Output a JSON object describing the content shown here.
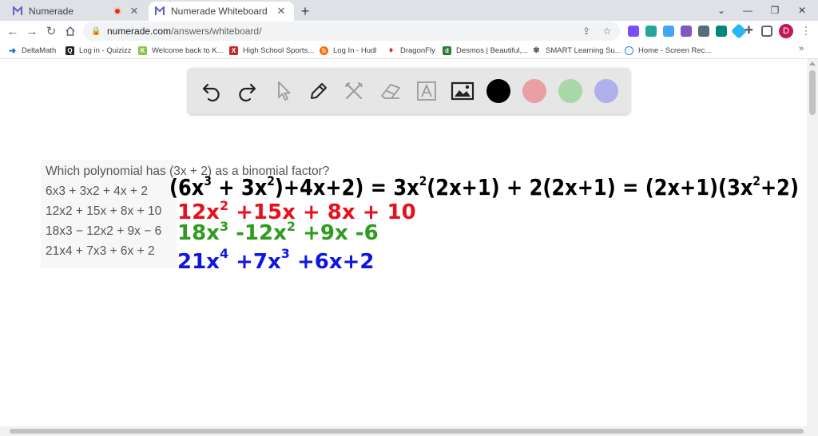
{
  "browser": {
    "tabs": [
      {
        "title": "Numerade",
        "active": false
      },
      {
        "title": "Numerade Whiteboard",
        "active": true
      }
    ],
    "url_host": "numerade.com",
    "url_path": "/answers/whiteboard/",
    "profile_initial": "D"
  },
  "bookmarks": [
    {
      "label": "DeltaMath",
      "icon": "deltamath-icon",
      "color": "#1565c0"
    },
    {
      "label": "Log in - Quizizz",
      "icon": "quizizz-icon",
      "color": "#222222"
    },
    {
      "label": "Welcome back to K...",
      "icon": "kahoot-icon",
      "color": "#8bc34a"
    },
    {
      "label": "High School Sports...",
      "icon": "sports-icon",
      "color": "#c62828"
    },
    {
      "label": "Log In - Hudl",
      "icon": "hudl-icon",
      "color": "#ff6d00"
    },
    {
      "label": "DragonFly",
      "icon": "dragonfly-icon",
      "color": "#d32f2f"
    },
    {
      "label": "Desmos | Beautiful,...",
      "icon": "desmos-icon",
      "color": "#2e7d32"
    },
    {
      "label": "SMART Learning Su...",
      "icon": "smart-icon",
      "color": "#616161"
    },
    {
      "label": "Home - Screen Rec...",
      "icon": "screenrec-icon",
      "color": "#1e88e5"
    }
  ],
  "whiteboard": {
    "colors": [
      "#000000",
      "#e8a0a4",
      "#a8d8a8",
      "#b0b0ec"
    ],
    "question": {
      "prompt": "Which polynomial has (3x + 2) as a binomial factor?",
      "options": [
        "6x3 + 3x2 + 4x + 2",
        "12x2 + 15x + 8x + 10",
        "18x3 − 12x2 + 9x − 6",
        "21x4 + 7x3 + 6x + 2"
      ]
    },
    "handwriting": {
      "line1": [
        "(6x",
        "3",
        " + 3x",
        "2",
        ")+4x+2) = 3x",
        "2",
        "(2x+1) + 2(2x+1) = (2x+1)(3x",
        "2",
        "+2)"
      ],
      "red": [
        "12x",
        "2",
        " +15x + 8x + 10"
      ],
      "green": [
        "18x",
        "3",
        " -12x",
        "2",
        " +9x -6"
      ],
      "blue": [
        "21x",
        "4",
        " +7x",
        "3",
        " +6x+2"
      ],
      "ink_colors": {
        "black": "#000000",
        "red": "#e8101c",
        "green": "#2e9a1e",
        "blue": "#1016e0"
      }
    }
  }
}
